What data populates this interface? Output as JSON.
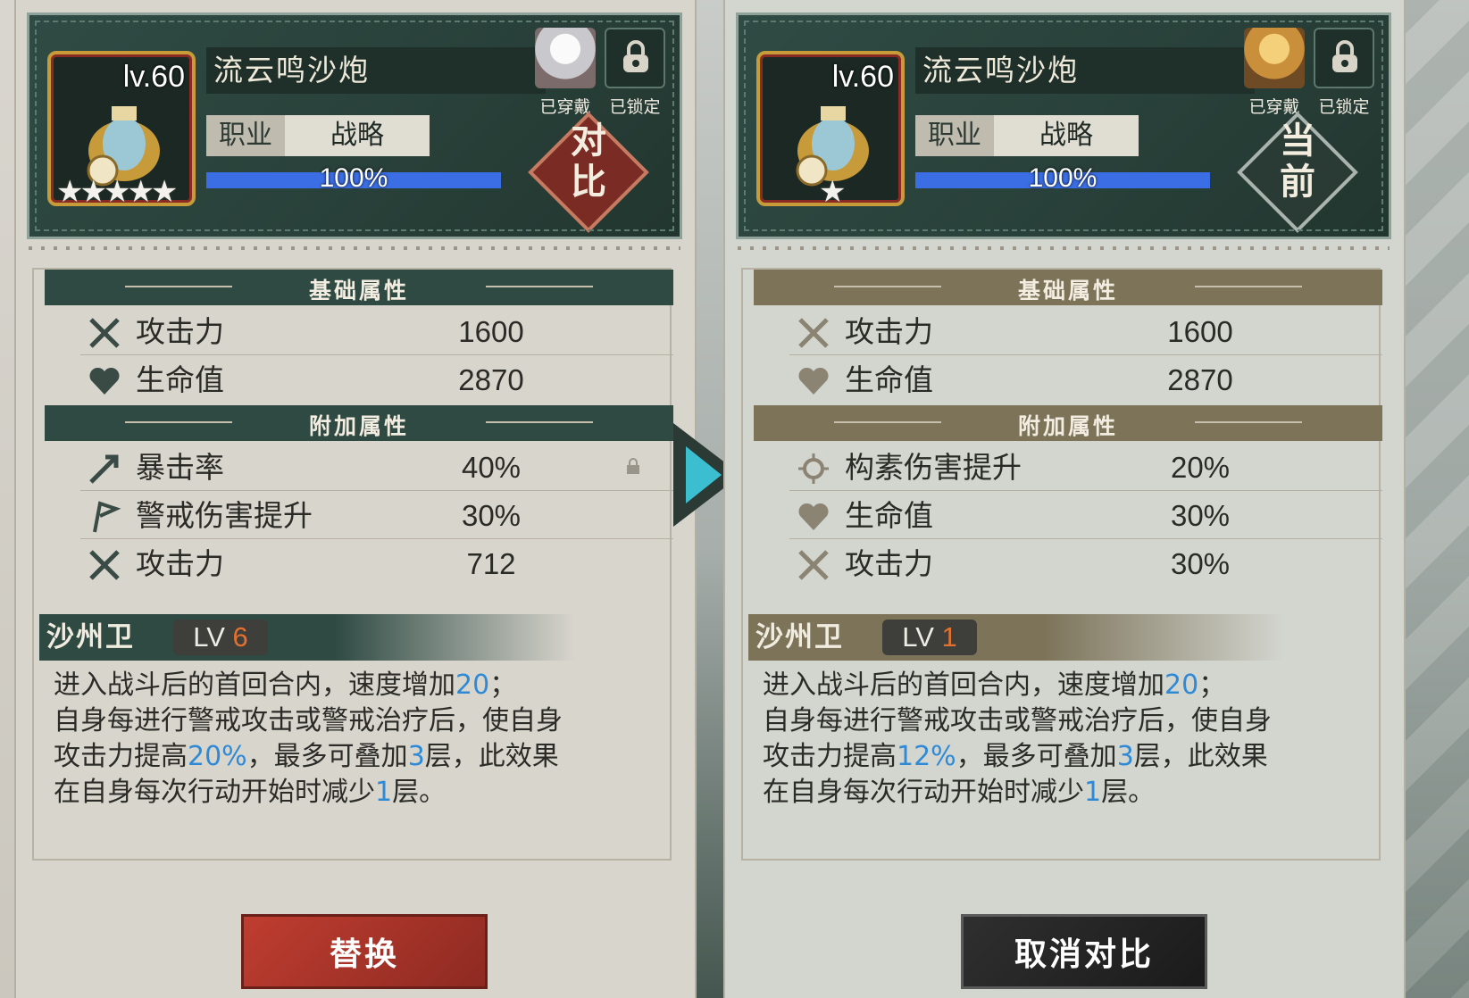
{
  "left": {
    "level": "lv.60",
    "name": "流云鸣沙炮",
    "stars": "★★★★★",
    "profession_label": "职业",
    "profession_value": "战略",
    "progress_text": "100%",
    "progress": 1.0,
    "equipped_tag": "已穿戴",
    "locked_tag": "已锁定",
    "badge": "对\n比",
    "base_title": "基础属性",
    "base_stats": [
      {
        "icon": "crossed-swords-icon",
        "label": "攻击力",
        "value": "1600"
      },
      {
        "icon": "heart-icon",
        "label": "生命值",
        "value": "2870"
      }
    ],
    "extra_title": "附加属性",
    "extra_stats": [
      {
        "icon": "critical-arrow-icon",
        "label": "暴击率",
        "value": "40%"
      },
      {
        "icon": "alert-flag-icon",
        "label": "警戒伤害提升",
        "value": "30%"
      },
      {
        "icon": "crossed-swords-icon",
        "label": "攻击力",
        "value": "712"
      }
    ],
    "skill_name": "沙州卫",
    "skill_lv_prefix": "LV ",
    "skill_lv": "6",
    "desc": {
      "l1a": "进入战斗后的首回合内，速度增加",
      "l1n": "20",
      "l1b": "；",
      "l2": "自身每进行警戒攻击或警戒治疗后，使自身",
      "l3a": "攻击力提高",
      "l3n": "20%",
      "l3b": "，最多可叠加",
      "l3n2": "3",
      "l3c": "层，此效果",
      "l4a": "在自身每次行动开始时减少",
      "l4n": "1",
      "l4b": "层。"
    },
    "button": "替换"
  },
  "right": {
    "level": "lv.60",
    "name": "流云鸣沙炮",
    "stars": "★",
    "profession_label": "职业",
    "profession_value": "战略",
    "progress_text": "100%",
    "progress": 1.0,
    "equipped_tag": "已穿戴",
    "locked_tag": "已锁定",
    "badge": "当\n前",
    "base_title": "基础属性",
    "base_stats": [
      {
        "icon": "crossed-swords-icon",
        "label": "攻击力",
        "value": "1600"
      },
      {
        "icon": "heart-icon",
        "label": "生命值",
        "value": "2870"
      }
    ],
    "extra_title": "附加属性",
    "extra_stats": [
      {
        "icon": "element-burst-icon",
        "label": "构素伤害提升",
        "value": "20%"
      },
      {
        "icon": "heart-icon",
        "label": "生命值",
        "value": "30%"
      },
      {
        "icon": "crossed-swords-icon",
        "label": "攻击力",
        "value": "30%"
      }
    ],
    "skill_name": "沙州卫",
    "skill_lv_prefix": "LV ",
    "skill_lv": "1",
    "desc": {
      "l1a": "进入战斗后的首回合内，速度增加",
      "l1n": "20",
      "l1b": "；",
      "l2": "自身每进行警戒攻击或警戒治疗后，使自身",
      "l3a": "攻击力提高",
      "l3n": "12%",
      "l3b": "，最多可叠加",
      "l3n2": "3",
      "l3c": "层，此效果",
      "l4a": "在自身每次行动开始时减少",
      "l4n": "1",
      "l4b": "层。"
    },
    "button": "取消对比"
  },
  "colors": {
    "card": "#2f4b44",
    "teal_header": "#2e4a43",
    "gold_header": "#7c7359",
    "highlight": "#2f8ad6",
    "level_num": "#e2712f",
    "replace_button": "#bf3d30",
    "cancel_button": "#1b1b1b",
    "arrow": "#3bbfd0"
  }
}
